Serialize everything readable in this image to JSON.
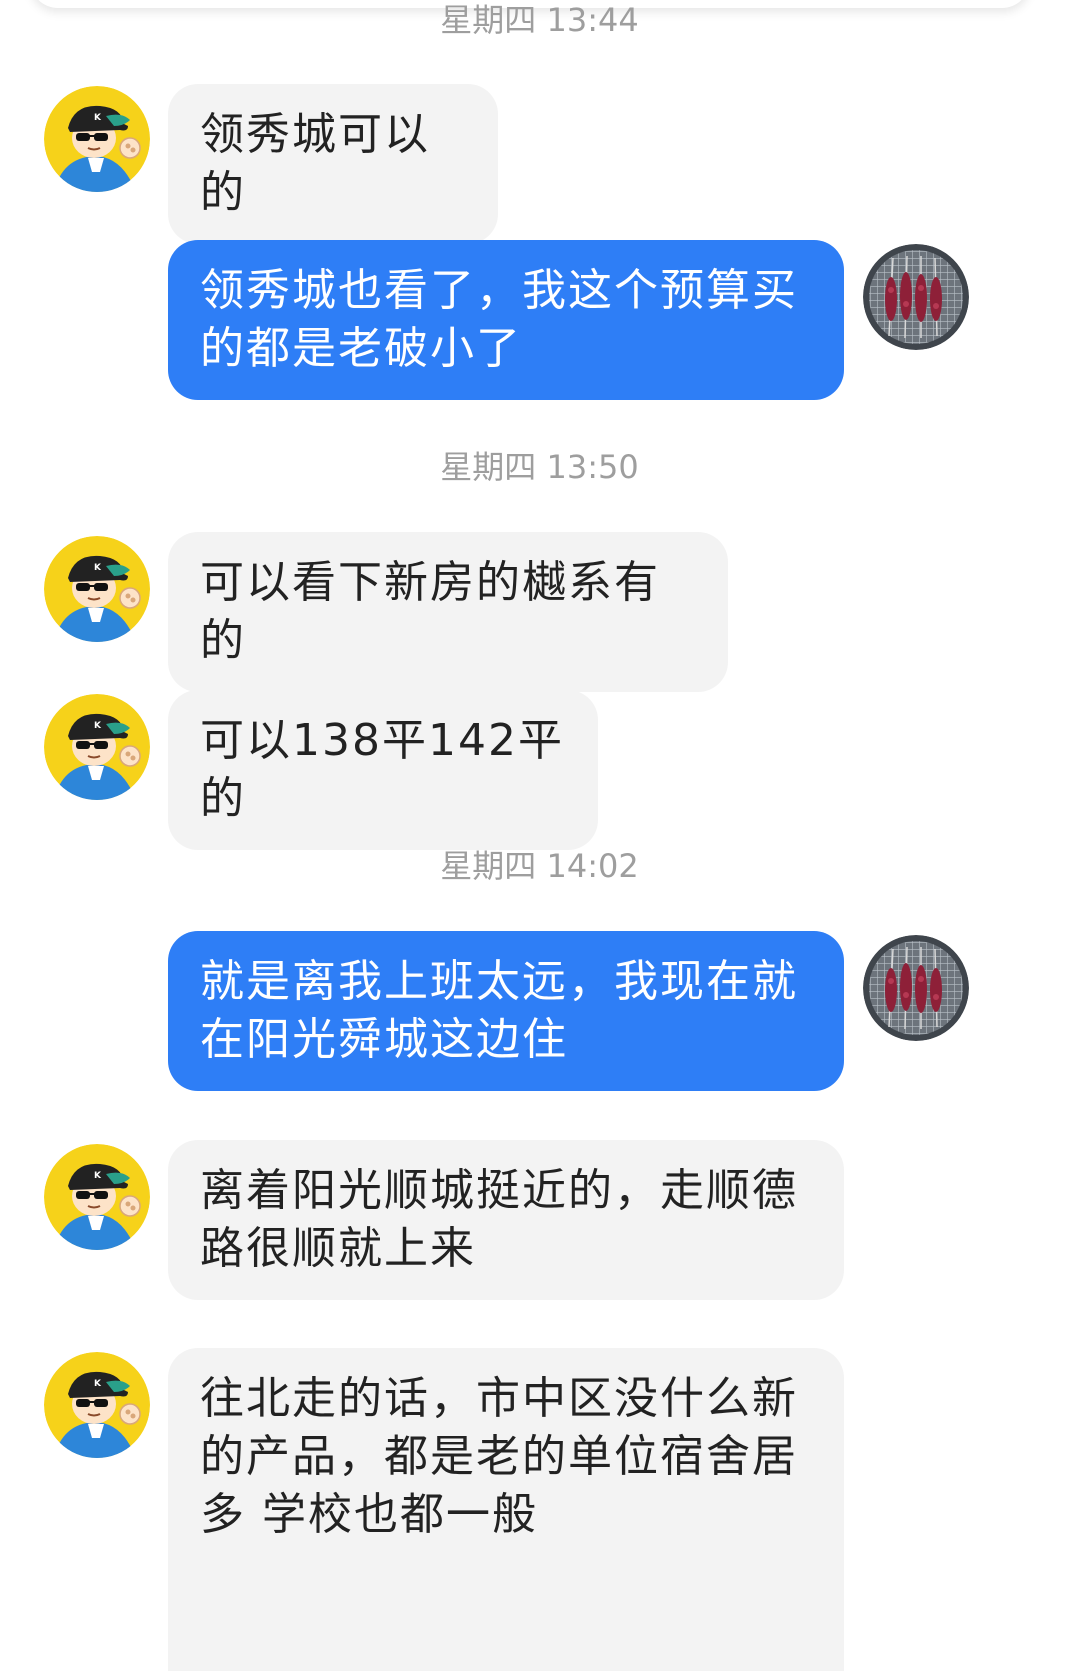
{
  "colors": {
    "incoming_bubble": "#f3f3f3",
    "outgoing_bubble": "#2e7ef6",
    "timestamp_text": "#9e9e9e"
  },
  "icons": {
    "contact_avatar": "cartoon-boy-cap-sunglasses-avatar",
    "self_avatar": "bbq-skewers-grill-avatar"
  },
  "timestamps": [
    "星期四 13:44",
    "星期四 13:50",
    "星期四 14:02"
  ],
  "messages": [
    {
      "from": "contact",
      "text": "领秀城可以的"
    },
    {
      "from": "self",
      "text": "领秀城也看了，我这个预算买的都是老破小了"
    },
    {
      "from": "contact",
      "text": "可以看下新房的樾系有的"
    },
    {
      "from": "contact",
      "text": "可以138平142平的"
    },
    {
      "from": "self",
      "text": "就是离我上班太远，我现在就在阳光舜城这边住"
    },
    {
      "from": "contact",
      "text": "离着阳光顺城挺近的，走顺德路很顺就上来"
    },
    {
      "from": "contact",
      "text": "往北走的话，市中区没什么新的产品，都是老的单位宿舍居多 学校也都一般"
    }
  ]
}
